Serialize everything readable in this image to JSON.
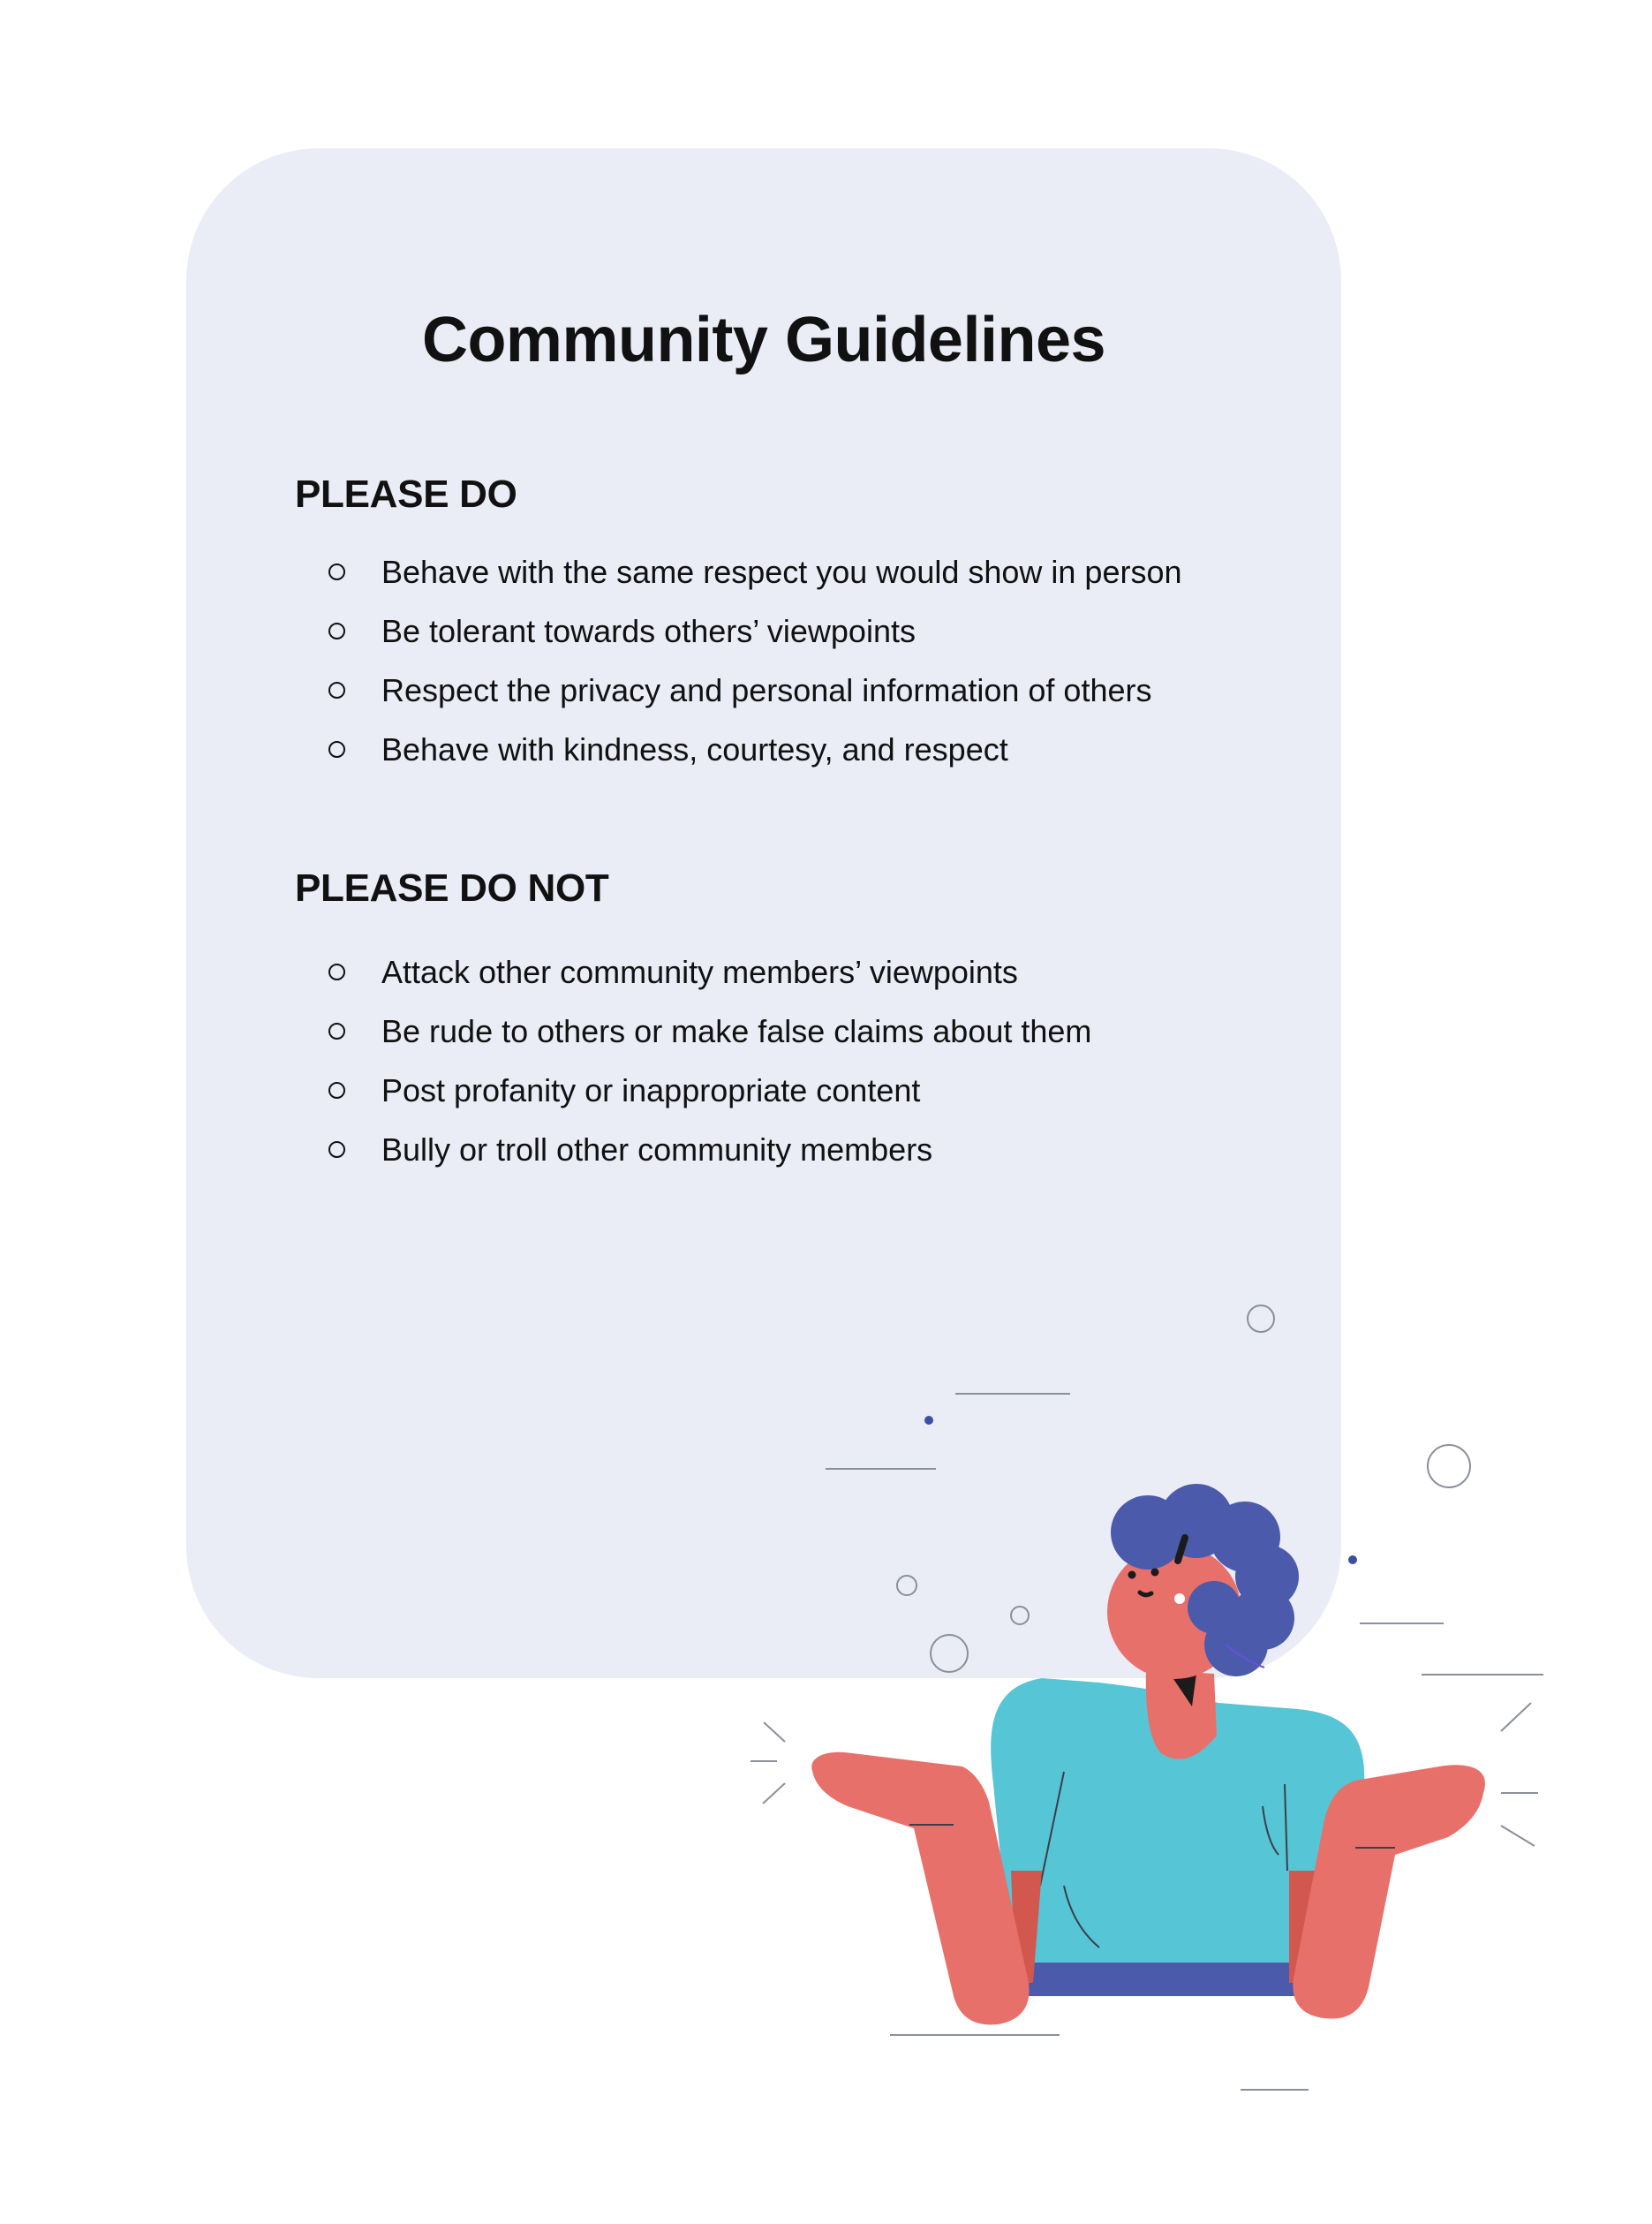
{
  "title": "Community Guidelines",
  "do_section": {
    "heading": "PLEASE DO",
    "items": [
      "Behave with the same respect you would show in person",
      "Be tolerant towards others’ viewpoints",
      "Respect the privacy and personal information of others",
      "Behave with kindness, courtesy, and respect"
    ]
  },
  "dont_section": {
    "heading": "PLEASE DO NOT",
    "items": [
      "Attack other community members’ viewpoints",
      "Be rude to others or make false claims about them",
      "Post profanity or inappropriate content",
      "Bully or troll other community members"
    ]
  },
  "colors": {
    "card_background": "#eaecf6",
    "hair": "#4b5aab",
    "skin": "#e8706a",
    "shirt": "#56c5d5",
    "pants": "#4b5aab"
  },
  "illustration": "person-shrugging"
}
